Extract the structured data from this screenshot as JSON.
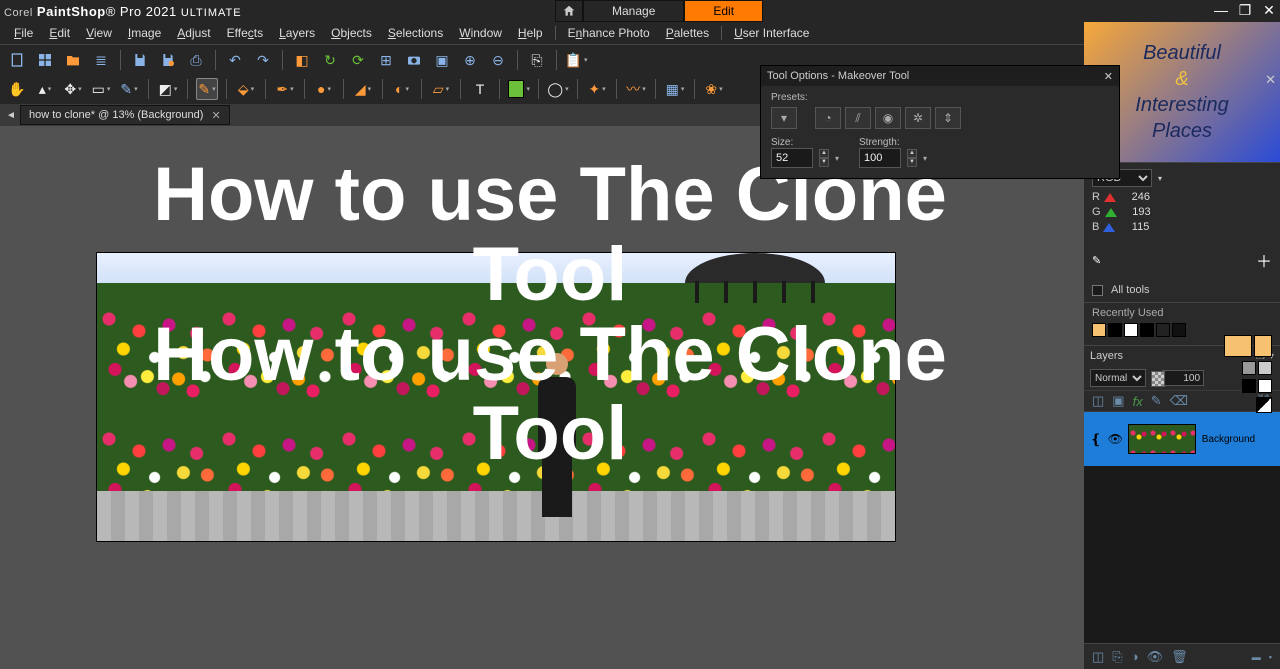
{
  "titlebar": {
    "brand_prefix": "Corel",
    "brand_main": "PaintShop",
    "brand_sub": "Pro 2021",
    "brand_edition": "ULTIMATE",
    "tabs": {
      "manage": "Manage",
      "edit": "Edit"
    }
  },
  "menu": {
    "file": "File",
    "edit": "Edit",
    "view": "View",
    "image": "Image",
    "adjust": "Adjust",
    "effects": "Effects",
    "layers": "Layers",
    "objects": "Objects",
    "selections": "Selections",
    "window": "Window",
    "help": "Help",
    "enhance": "Enhance Photo",
    "palettes": "Palettes",
    "ui": "User Interface"
  },
  "doc_tab": {
    "title": "how to clone*  @   13% (Background)"
  },
  "tool_options": {
    "title": "Tool Options - Makeover Tool",
    "presets_label": "Presets:",
    "size_label": "Size:",
    "size_value": "52",
    "strength_label": "Strength:",
    "strength_value": "100"
  },
  "overlay": {
    "line1": "How to use The Clone",
    "line2": "Tool",
    "line3": "How to use The Clone",
    "line4": "Tool"
  },
  "brandbox": {
    "l1": "Beautiful",
    "amp": "&",
    "l2": "Interesting",
    "l3": "Places"
  },
  "colors": {
    "mode": "RGB",
    "r_label": "R",
    "r": "246",
    "g_label": "G",
    "g": "193",
    "b_label": "B",
    "b": "115",
    "all_tools": "All tools"
  },
  "recent": {
    "label": "Recently Used",
    "swatches": [
      "#f6c170",
      "#000000",
      "#ffffff",
      "#000000",
      "#222222",
      "#111111"
    ]
  },
  "layers": {
    "title": "Layers",
    "blend": "Normal",
    "opacity": "100",
    "row_name": "Background"
  }
}
